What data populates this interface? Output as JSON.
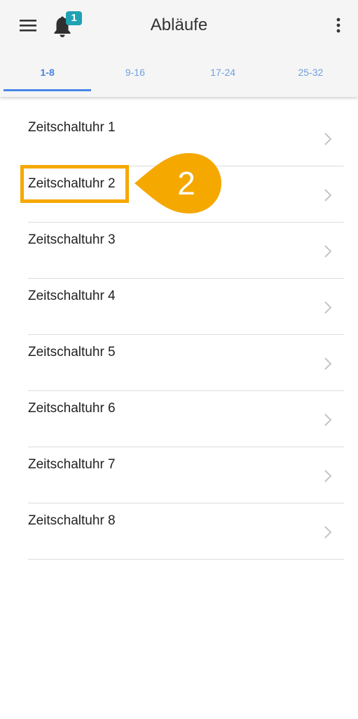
{
  "header": {
    "title": "Abläufe",
    "notification_count": "1"
  },
  "tabs": [
    {
      "label": "1-8",
      "active": true
    },
    {
      "label": "9-16",
      "active": false
    },
    {
      "label": "17-24",
      "active": false
    },
    {
      "label": "25-32",
      "active": false
    }
  ],
  "items": [
    {
      "label": "Zeitschaltuhr 1"
    },
    {
      "label": "Zeitschaltuhr 2"
    },
    {
      "label": "Zeitschaltuhr 3"
    },
    {
      "label": "Zeitschaltuhr 4"
    },
    {
      "label": "Zeitschaltuhr 5"
    },
    {
      "label": "Zeitschaltuhr 6"
    },
    {
      "label": "Zeitschaltuhr 7"
    },
    {
      "label": "Zeitschaltuhr 8"
    }
  ],
  "annotation": {
    "step_number": "2",
    "color": "#f5a800"
  },
  "icons": {
    "menu": "hamburger-menu-icon",
    "bell": "bell-icon",
    "more": "more-vert-icon",
    "chevron": "chevron-right-icon"
  },
  "colors": {
    "accent": "#4a86e8",
    "badge": "#1fa2b4",
    "appbar": "#f5f5f5"
  }
}
